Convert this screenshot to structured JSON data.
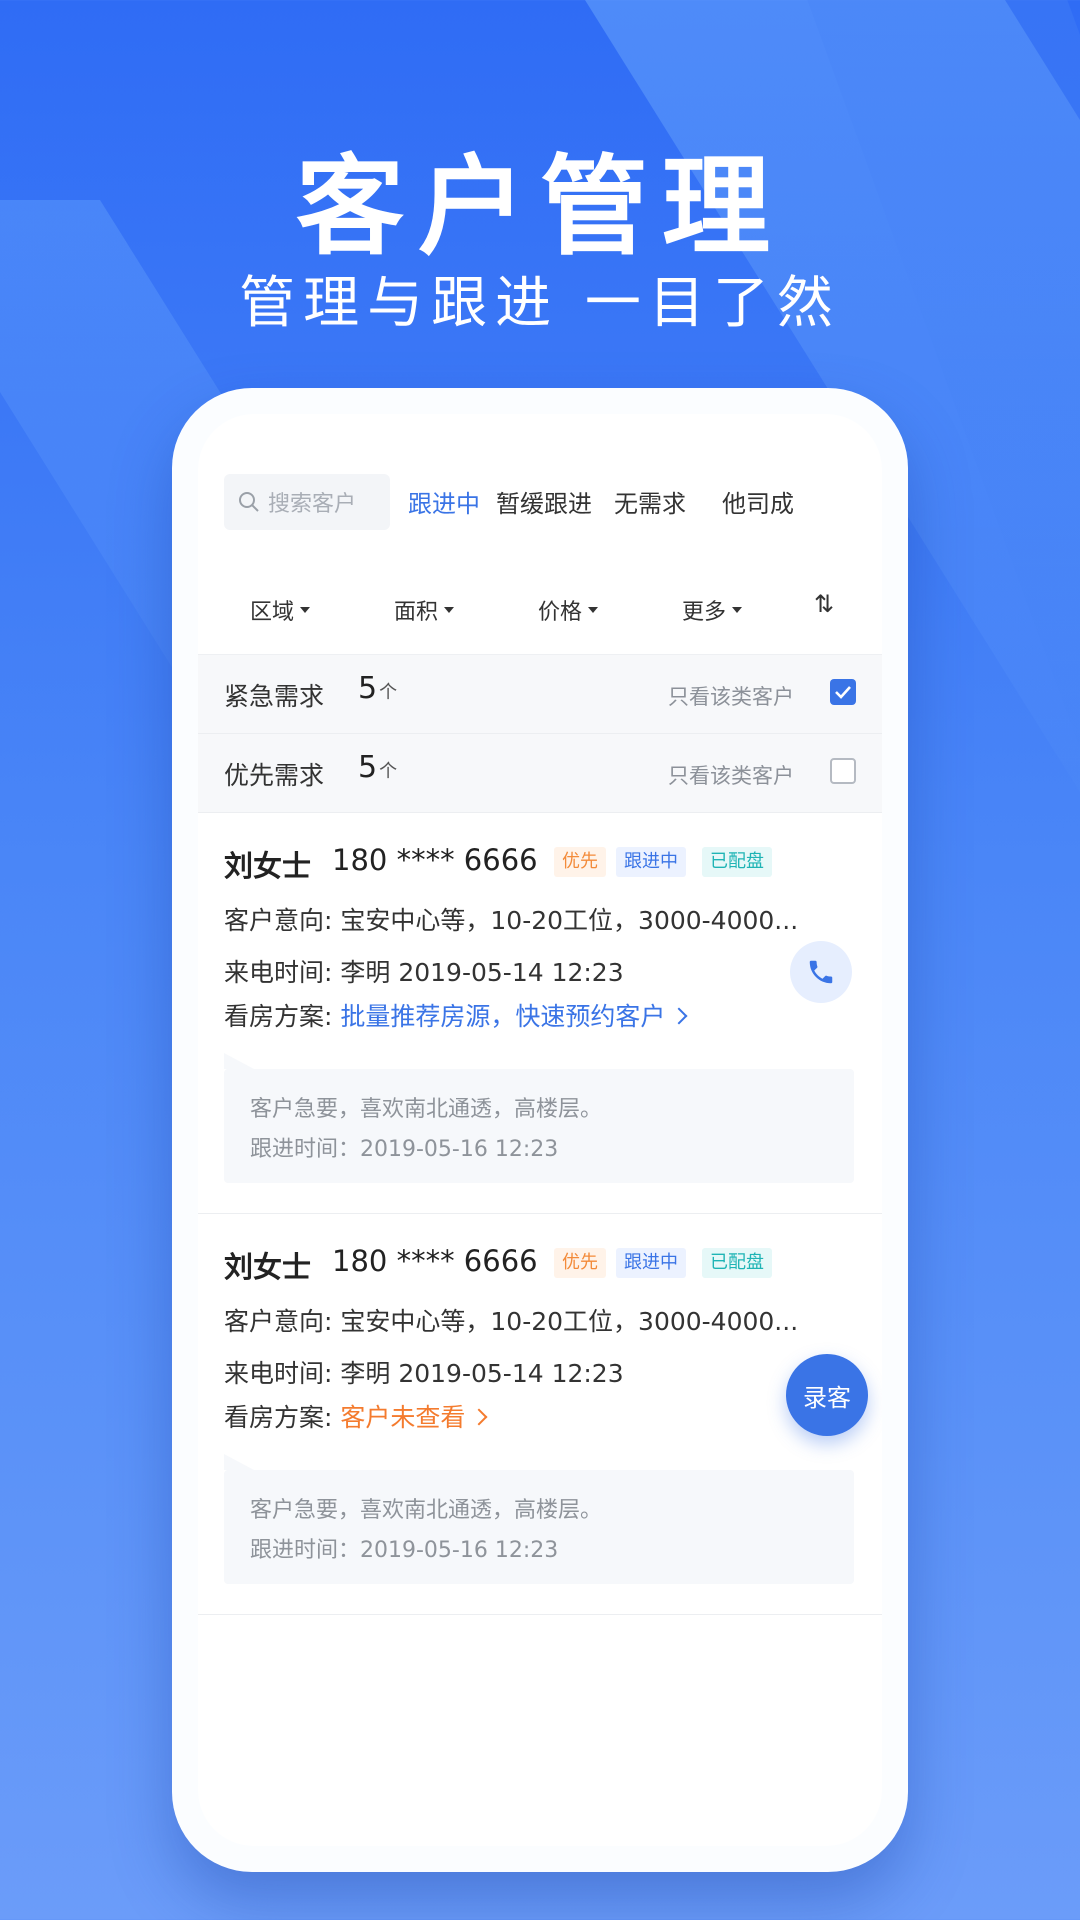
{
  "headline": {
    "title": "客户管理",
    "subtitle": "管理与跟进  一目了然"
  },
  "search": {
    "placeholder": "搜索客户"
  },
  "tabs": [
    {
      "label": "跟进中",
      "active": true
    },
    {
      "label": "暂缓跟进",
      "active": false
    },
    {
      "label": "无需求",
      "active": false
    },
    {
      "label": "他司成",
      "active": false
    }
  ],
  "filters": [
    {
      "label": "区域"
    },
    {
      "label": "面积"
    },
    {
      "label": "价格"
    },
    {
      "label": "更多"
    }
  ],
  "sort_icon": "⇅",
  "categories": [
    {
      "label": "紧急需求",
      "count": "5",
      "unit": "个",
      "only_label": "只看该类客户",
      "checked": true
    },
    {
      "label": "优先需求",
      "count": "5",
      "unit": "个",
      "only_label": "只看该类客户",
      "checked": false
    }
  ],
  "customers": [
    {
      "name": "刘女士",
      "phone": "180 **** 6666",
      "tags": [
        "优先",
        "跟进中",
        "已配盘"
      ],
      "intent_label": "客户意向:",
      "intent_value": "宝安中心等，10-20工位，3000-4000...",
      "call_label": "来电时间:",
      "call_value": "李明   2019-05-14 12:23",
      "plan_label": "看房方案:",
      "plan_value": "批量推荐房源，快速预约客户",
      "note_line1": "客户急要，喜欢南北通透，高楼层。",
      "note_line2": "跟进时间：2019-05-16 12:23"
    },
    {
      "name": "刘女士",
      "phone": "180 **** 6666",
      "tags": [
        "优先",
        "跟进中",
        "已配盘"
      ],
      "intent_label": "客户意向:",
      "intent_value": "宝安中心等，10-20工位，3000-4000...",
      "call_label": "来电时间:",
      "call_value": "李明   2019-05-14 12:23",
      "plan_label": "看房方案:",
      "plan_value": "客户未查看",
      "note_line1": "客户急要，喜欢南北通透，高楼层。",
      "note_line2": "跟进时间：2019-05-16 12:23"
    }
  ],
  "fab_label": "录客",
  "colors": {
    "accent": "#3a74e6",
    "orange": "#f47b2e",
    "teal": "#1fb4b5"
  }
}
